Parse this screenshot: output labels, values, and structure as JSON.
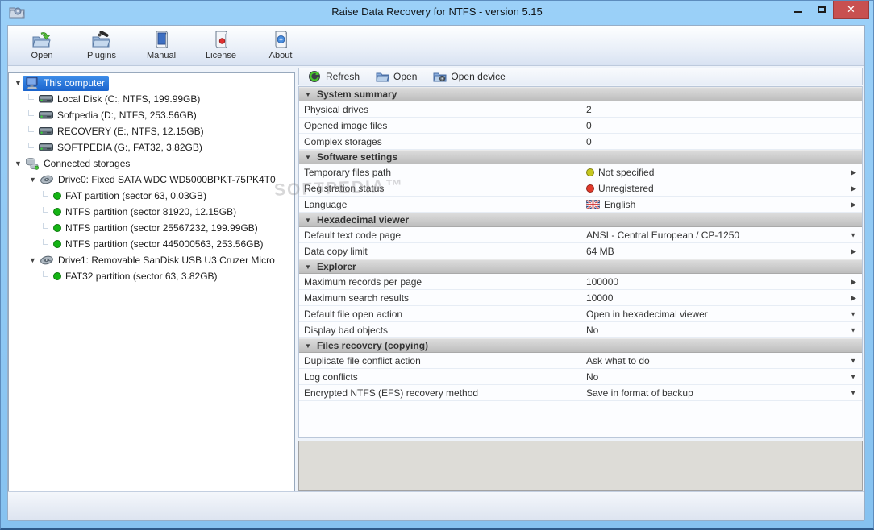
{
  "window": {
    "title": "Raise Data Recovery for NTFS - version 5.15",
    "buttons": {
      "minimize": "minimize",
      "maximize": "maximize",
      "close": "close"
    }
  },
  "watermark": "SOFTPEDIA™",
  "toolbar": {
    "buttons": [
      {
        "name": "open",
        "label": "Open",
        "icon": "open-icon"
      },
      {
        "name": "plugins",
        "label": "Plugins",
        "icon": "plugins-icon"
      },
      {
        "name": "manual",
        "label": "Manual",
        "icon": "manual-icon"
      },
      {
        "name": "license",
        "label": "License",
        "icon": "license-icon"
      },
      {
        "name": "about",
        "label": "About",
        "icon": "about-icon"
      }
    ]
  },
  "right_toolbar": {
    "buttons": [
      {
        "name": "refresh",
        "label": "Refresh",
        "icon": "refresh-icon"
      },
      {
        "name": "open",
        "label": "Open",
        "icon": "open-folder-icon"
      },
      {
        "name": "open-device",
        "label": "Open device",
        "icon": "open-device-icon"
      }
    ]
  },
  "tree": {
    "items": [
      {
        "level": 0,
        "icon": "computer-icon",
        "label": "This computer",
        "selected": true,
        "expander": true
      },
      {
        "level": 1,
        "icon": "drive-icon",
        "label": "Local Disk (C:, NTFS, 199.99GB)"
      },
      {
        "level": 1,
        "icon": "drive-icon",
        "label": "Softpedia (D:, NTFS, 253.56GB)"
      },
      {
        "level": 1,
        "icon": "drive-icon",
        "label": "RECOVERY (E:, NTFS, 12.15GB)"
      },
      {
        "level": 1,
        "icon": "drive-icon",
        "label": "SOFTPEDIA (G:, FAT32, 3.82GB)"
      },
      {
        "level": 0,
        "icon": "storages-icon",
        "label": "Connected storages",
        "expander": true
      },
      {
        "level": 1,
        "icon": "disk-icon",
        "label": "Drive0: Fixed SATA WDC WD5000BPKT-75PK4T0",
        "expander": true
      },
      {
        "level": 2,
        "icon": "partition-dot",
        "label": "FAT partition (sector 63, 0.03GB)"
      },
      {
        "level": 2,
        "icon": "partition-dot",
        "label": "NTFS partition (sector 81920, 12.15GB)"
      },
      {
        "level": 2,
        "icon": "partition-dot",
        "label": "NTFS partition (sector 25567232, 199.99GB)"
      },
      {
        "level": 2,
        "icon": "partition-dot",
        "label": "NTFS partition (sector 445000563, 253.56GB)"
      },
      {
        "level": 1,
        "icon": "disk-icon",
        "label": "Drive1: Removable SanDisk USB U3 Cruzer Micro",
        "expander": true
      },
      {
        "level": 2,
        "icon": "partition-dot",
        "label": "FAT32 partition (sector 63, 3.82GB)"
      }
    ]
  },
  "settings": {
    "sections": [
      {
        "title": "System summary",
        "rows": [
          {
            "label": "Physical drives",
            "value": "2"
          },
          {
            "label": "Opened image files",
            "value": "0"
          },
          {
            "label": "Complex storages",
            "value": "0"
          }
        ]
      },
      {
        "title": "Software settings",
        "rows": [
          {
            "label": "Temporary files path",
            "value": "Not specified",
            "dot": "#c6c71e",
            "arrow": "right"
          },
          {
            "label": "Registration status",
            "value": "Unregistered",
            "dot": "#e23a2b",
            "arrow": "right"
          },
          {
            "label": "Language",
            "value": "English",
            "flag": "uk-flag-icon",
            "arrow": "right"
          }
        ]
      },
      {
        "title": "Hexadecimal viewer",
        "rows": [
          {
            "label": "Default text code page",
            "value": "ANSI - Central European / CP-1250",
            "arrow": "down"
          },
          {
            "label": "Data copy limit",
            "value": "64 MB",
            "arrow": "right"
          }
        ]
      },
      {
        "title": "Explorer",
        "rows": [
          {
            "label": "Maximum records per page",
            "value": "100000",
            "arrow": "right"
          },
          {
            "label": "Maximum search results",
            "value": "10000",
            "arrow": "right"
          },
          {
            "label": "Default file open action",
            "value": "Open in hexadecimal viewer",
            "arrow": "down"
          },
          {
            "label": "Display bad objects",
            "value": "No",
            "arrow": "down"
          }
        ]
      },
      {
        "title": "Files recovery (copying)",
        "rows": [
          {
            "label": "Duplicate file conflict action",
            "value": "Ask what to do",
            "arrow": "down"
          },
          {
            "label": "Log conflicts",
            "value": "No",
            "arrow": "down"
          },
          {
            "label": "Encrypted NTFS (EFS) recovery method",
            "value": "Save in format of backup",
            "arrow": "down"
          }
        ]
      }
    ]
  },
  "colors": {
    "titlebar": "#8ec6f3",
    "close_button": "#c85050",
    "selection": "#2a7ae0",
    "partition_green": "#14b414",
    "status_yellow": "#c6c71e",
    "status_red": "#e23a2b"
  }
}
